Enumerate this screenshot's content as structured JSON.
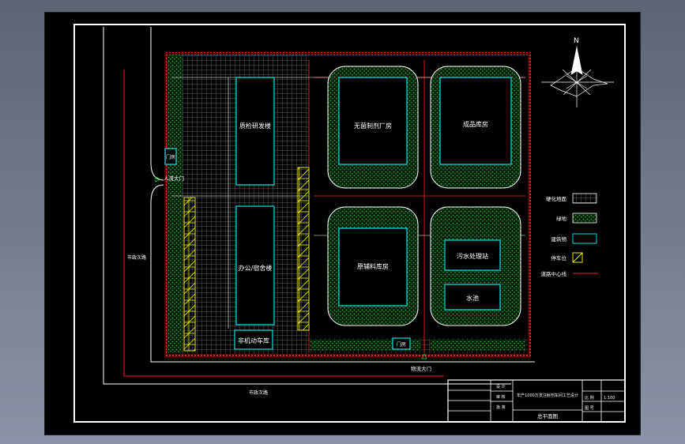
{
  "drawing": {
    "north_label": "N",
    "buildings": {
      "qa_rd": "质检研发楼",
      "aseptic_plant": "无菌制剂厂房",
      "finished_warehouse": "成品库房",
      "office_dorm": "办公/宿舍楼",
      "raw_material_warehouse": "原辅料库房",
      "sewage_station": "污水处理站",
      "pool": "水池",
      "bike_shed": "非机动车库",
      "gatehouse_north": "门房",
      "gatehouse_south": "门房"
    },
    "gates": {
      "people_gate": "人流大门",
      "logistics_gate": "物流大门"
    },
    "roads": {
      "road_west": "市政次路",
      "road_south": "市政次路"
    },
    "legend": [
      {
        "key": "paved",
        "label": "硬化地面"
      },
      {
        "key": "green",
        "label": "绿地"
      },
      {
        "key": "building",
        "label": "建筑物"
      },
      {
        "key": "parking",
        "label": "停车位"
      },
      {
        "key": "centerline",
        "label": "道路中心线"
      }
    ],
    "title_block": {
      "design_row": "设 计",
      "check_row": "审 核",
      "approve_row": "批 准",
      "project": "年产1000万支注射剂车间工艺设计",
      "drawing_title": "总平面图",
      "scale_label": "比 例",
      "scale_value": "1:100",
      "sheet_label": "图 号"
    },
    "colors": {
      "frame": "#ffffff",
      "site_boundary": "#ff2020",
      "building": "#00e5e5",
      "green": "#2bbf3f",
      "parking": "#e8e800",
      "centerline": "#ff2020"
    }
  }
}
